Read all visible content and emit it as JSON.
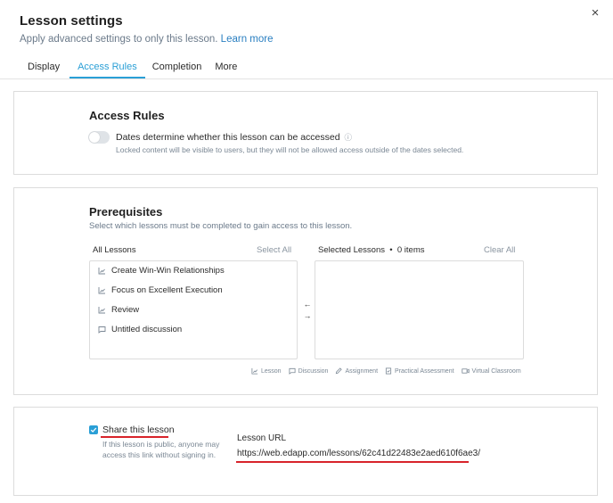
{
  "dialog": {
    "title": "Lesson settings",
    "subtitle": "Apply advanced settings to only this lesson.",
    "learn_more": "Learn more",
    "close_label": "×"
  },
  "tabs": [
    {
      "label": "Display",
      "active": false
    },
    {
      "label": "Access Rules",
      "active": true
    },
    {
      "label": "Completion",
      "active": false
    },
    {
      "label": "More",
      "active": false
    }
  ],
  "access_rules": {
    "title": "Access Rules",
    "toggle_label": "Dates determine whether this lesson can be accessed",
    "toggle_on": false,
    "info_icon": "ⓘ",
    "hint": "Locked content will be visible to users, but they will not be allowed access outside of the dates selected."
  },
  "prerequisites": {
    "title": "Prerequisites",
    "description": "Select which lessons must be completed to gain access to this lesson.",
    "all_lessons_header": "All Lessons",
    "select_all": "Select All",
    "selected_header": "Selected Lessons  •  0 items",
    "clear_all": "Clear All",
    "lessons": [
      {
        "label": "Create Win-Win Relationships",
        "icon": "lesson-icon"
      },
      {
        "label": "Focus on Excellent Execution",
        "icon": "lesson-icon"
      },
      {
        "label": "Review",
        "icon": "lesson-icon"
      },
      {
        "label": "Untitled discussion",
        "icon": "discussion-icon"
      }
    ],
    "arrow_left": "←",
    "arrow_right": "→",
    "legend": [
      {
        "label": "Lesson",
        "icon": "lesson-icon"
      },
      {
        "label": "Discussion",
        "icon": "discussion-icon"
      },
      {
        "label": "Assignment",
        "icon": "assignment-icon"
      },
      {
        "label": "Practical Assessment",
        "icon": "practical-assessment-icon"
      },
      {
        "label": "Virtual Classroom",
        "icon": "virtual-classroom-icon"
      }
    ]
  },
  "share": {
    "checked": true,
    "label": "Share this lesson",
    "hint": "If this lesson is public, anyone may access this link without signing in.",
    "url_label": "Lesson URL",
    "url": "https://web.edapp.com/lessons/62c41d22483e2aed610f6ae3/"
  },
  "colors": {
    "accent": "#2a9fd6",
    "annotation": "#d8232a",
    "link": "#2a7fc1"
  }
}
